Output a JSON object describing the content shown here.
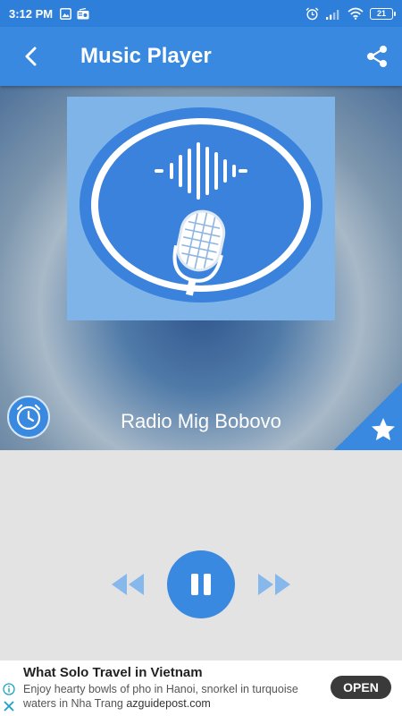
{
  "status_bar": {
    "time": "3:12 PM",
    "battery_level": "21"
  },
  "app_bar": {
    "title": "Music Player"
  },
  "player": {
    "station_name": "Radio Mig Bobovo",
    "state": "playing"
  },
  "ad": {
    "headline": "What Solo Travel in Vietnam",
    "description": "Enjoy hearty bowls of pho in Hanoi, snorkel in turquoise waters in Nha Trang",
    "domain": "azguidepost.com",
    "cta": "OPEN"
  },
  "colors": {
    "primary": "#3a89e0",
    "status_bar": "#2d7fd9",
    "controls_bg": "#e3e3e3"
  },
  "icons": [
    "back-arrow-icon",
    "share-icon",
    "clock-icon",
    "star-icon",
    "rewind-icon",
    "pause-icon",
    "fast-forward-icon",
    "info-icon",
    "close-icon"
  ]
}
